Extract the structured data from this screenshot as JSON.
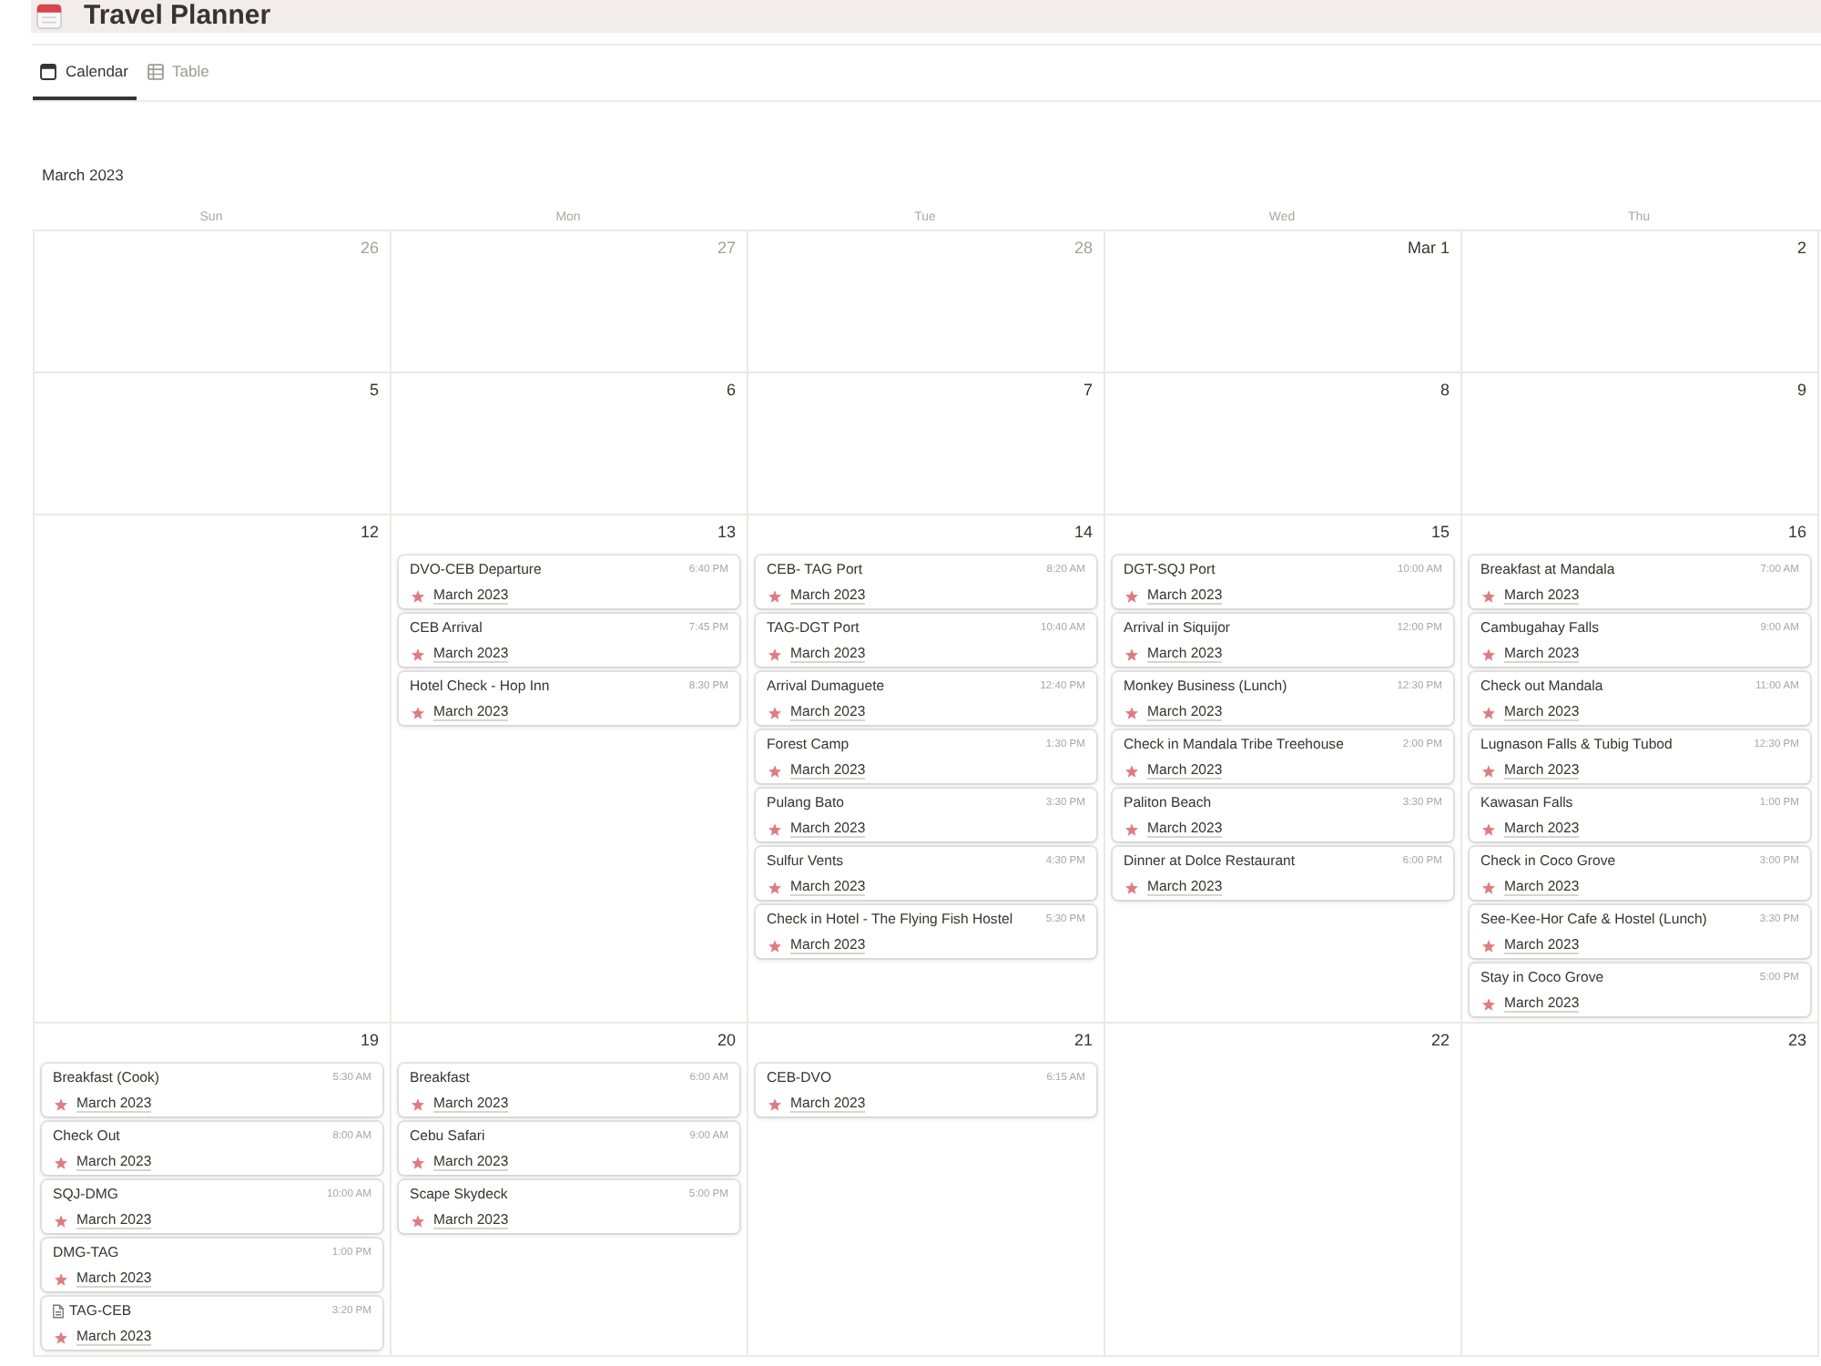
{
  "page": {
    "title": "Travel Planner"
  },
  "tabs": [
    {
      "label": "Calendar",
      "kind": "calendar",
      "selected": true
    },
    {
      "label": "Table",
      "kind": "table",
      "selected": false
    }
  ],
  "calendar": {
    "month": "March 2023",
    "columns": [
      "Sun",
      "Mon",
      "Tue",
      "Wed",
      "Thu"
    ],
    "weeks": [
      {
        "days": [
          {
            "date": "26",
            "outside_month": true
          },
          {
            "date": "27",
            "outside_month": true
          },
          {
            "date": "28",
            "outside_month": true
          },
          {
            "date": "Mar 1",
            "outside_month": false
          },
          {
            "date": "2",
            "outside_month": false
          }
        ]
      },
      {
        "days": [
          {
            "date": "5",
            "outside_month": false
          },
          {
            "date": "6",
            "outside_month": false
          },
          {
            "date": "7",
            "outside_month": false
          },
          {
            "date": "8",
            "outside_month": false
          },
          {
            "date": "9",
            "outside_month": false
          }
        ]
      },
      {
        "days": [
          {
            "date": "12",
            "outside_month": false
          },
          {
            "date": "13",
            "outside_month": false,
            "events": [
              {
                "kind": "event",
                "name": "DVO-CEB Departure",
                "time": "6:40 PM",
                "relation": "March 2023"
              },
              {
                "kind": "event",
                "name": "CEB Arrival",
                "time": "7:45 PM",
                "relation": "March 2023"
              },
              {
                "kind": "event",
                "name": "Hotel Check - Hop Inn",
                "time": "8:30 PM",
                "relation": "March 2023"
              }
            ]
          },
          {
            "date": "14",
            "outside_month": false,
            "events": [
              {
                "kind": "event",
                "name": "CEB- TAG Port",
                "time": "8:20 AM",
                "relation": "March 2023"
              },
              {
                "kind": "event",
                "name": "TAG-DGT Port",
                "time": "10:40 AM",
                "relation": "March 2023"
              },
              {
                "kind": "event",
                "name": "Arrival Dumaguete",
                "time": "12:40 PM",
                "relation": "March 2023"
              },
              {
                "kind": "event",
                "name": "Forest Camp",
                "time": "1:30 PM",
                "relation": "March 2023"
              },
              {
                "kind": "event",
                "name": "Pulang Bato",
                "time": "3:30 PM",
                "relation": "March 2023"
              },
              {
                "kind": "event",
                "name": "Sulfur Vents",
                "time": "4:30 PM",
                "relation": "March 2023"
              },
              {
                "kind": "event",
                "name": "Check in Hotel - The Flying Fish Hostel",
                "time": "5:30 PM",
                "relation": "March 2023"
              }
            ]
          },
          {
            "date": "15",
            "outside_month": false,
            "events": [
              {
                "kind": "event",
                "name": "DGT-SQJ Port",
                "time": "10:00 AM",
                "relation": "March 2023"
              },
              {
                "kind": "event",
                "name": "Arrival in Siquijor",
                "time": "12:00 PM",
                "relation": "March 2023"
              },
              {
                "kind": "event",
                "name": "Monkey Business (Lunch)",
                "time": "12:30 PM",
                "relation": "March 2023"
              },
              {
                "kind": "event",
                "name": "Check in Mandala Tribe Treehouse",
                "time": "2:00 PM",
                "relation": "March 2023"
              },
              {
                "kind": "event",
                "name": "Paliton Beach",
                "time": "3:30 PM",
                "relation": "March 2023"
              },
              {
                "kind": "event",
                "name": "Dinner at Dolce Restaurant",
                "time": "6:00 PM",
                "relation": "March 2023"
              }
            ]
          },
          {
            "date": "16",
            "outside_month": false,
            "events": [
              {
                "kind": "event",
                "name": "Breakfast at Mandala",
                "time": "7:00 AM",
                "relation": "March 2023"
              },
              {
                "kind": "event",
                "name": "Cambugahay Falls",
                "time": "9:00 AM",
                "relation": "March 2023"
              },
              {
                "kind": "event",
                "name": "Check out Mandala",
                "time": "11:00 AM",
                "relation": "March 2023"
              },
              {
                "kind": "event",
                "name": "Lugnason Falls & Tubig Tubod",
                "time": "12:30 PM",
                "relation": "March 2023"
              },
              {
                "kind": "event",
                "name": "Kawasan Falls",
                "time": "1:00 PM",
                "relation": "March 2023"
              },
              {
                "kind": "event",
                "name": "Check in Coco Grove",
                "time": "3:00 PM",
                "relation": "March 2023"
              },
              {
                "kind": "event",
                "name": "See-Kee-Hor Cafe & Hostel (Lunch)",
                "time": "3:30 PM",
                "relation": "March 2023"
              },
              {
                "kind": "event",
                "name": "Stay in Coco Grove",
                "time": "5:00 PM",
                "relation": "March 2023"
              }
            ]
          }
        ]
      },
      {
        "days": [
          {
            "date": "19",
            "outside_month": false,
            "events": [
              {
                "kind": "event",
                "name": "Breakfast (Cook)",
                "time": "5:30 AM",
                "relation": "March 2023"
              },
              {
                "kind": "event",
                "name": "Check Out",
                "time": "8:00 AM",
                "relation": "March 2023"
              },
              {
                "kind": "event",
                "name": "SQJ-DMG",
                "time": "10:00 AM",
                "relation": "March 2023"
              },
              {
                "kind": "event",
                "name": "DMG-TAG",
                "time": "1:00 PM",
                "relation": "March 2023"
              },
              {
                "kind": "page",
                "name": "TAG-CEB",
                "time": "3:20 PM",
                "relation": "March 2023"
              }
            ]
          },
          {
            "date": "20",
            "outside_month": false,
            "events": [
              {
                "kind": "event",
                "name": "Breakfast",
                "time": "6:00 AM",
                "relation": "March 2023"
              },
              {
                "kind": "event",
                "name": "Cebu Safari",
                "time": "9:00 AM",
                "relation": "March 2023"
              },
              {
                "kind": "event",
                "name": "Scape Skydeck",
                "time": "5:00 PM",
                "relation": "March 2023"
              }
            ]
          },
          {
            "date": "21",
            "outside_month": false,
            "events": [
              {
                "kind": "event",
                "name": "CEB-DVO",
                "time": "6:15 AM",
                "relation": "March 2023"
              }
            ]
          },
          {
            "date": "22",
            "outside_month": false
          },
          {
            "date": "23",
            "outside_month": false
          }
        ]
      }
    ]
  }
}
